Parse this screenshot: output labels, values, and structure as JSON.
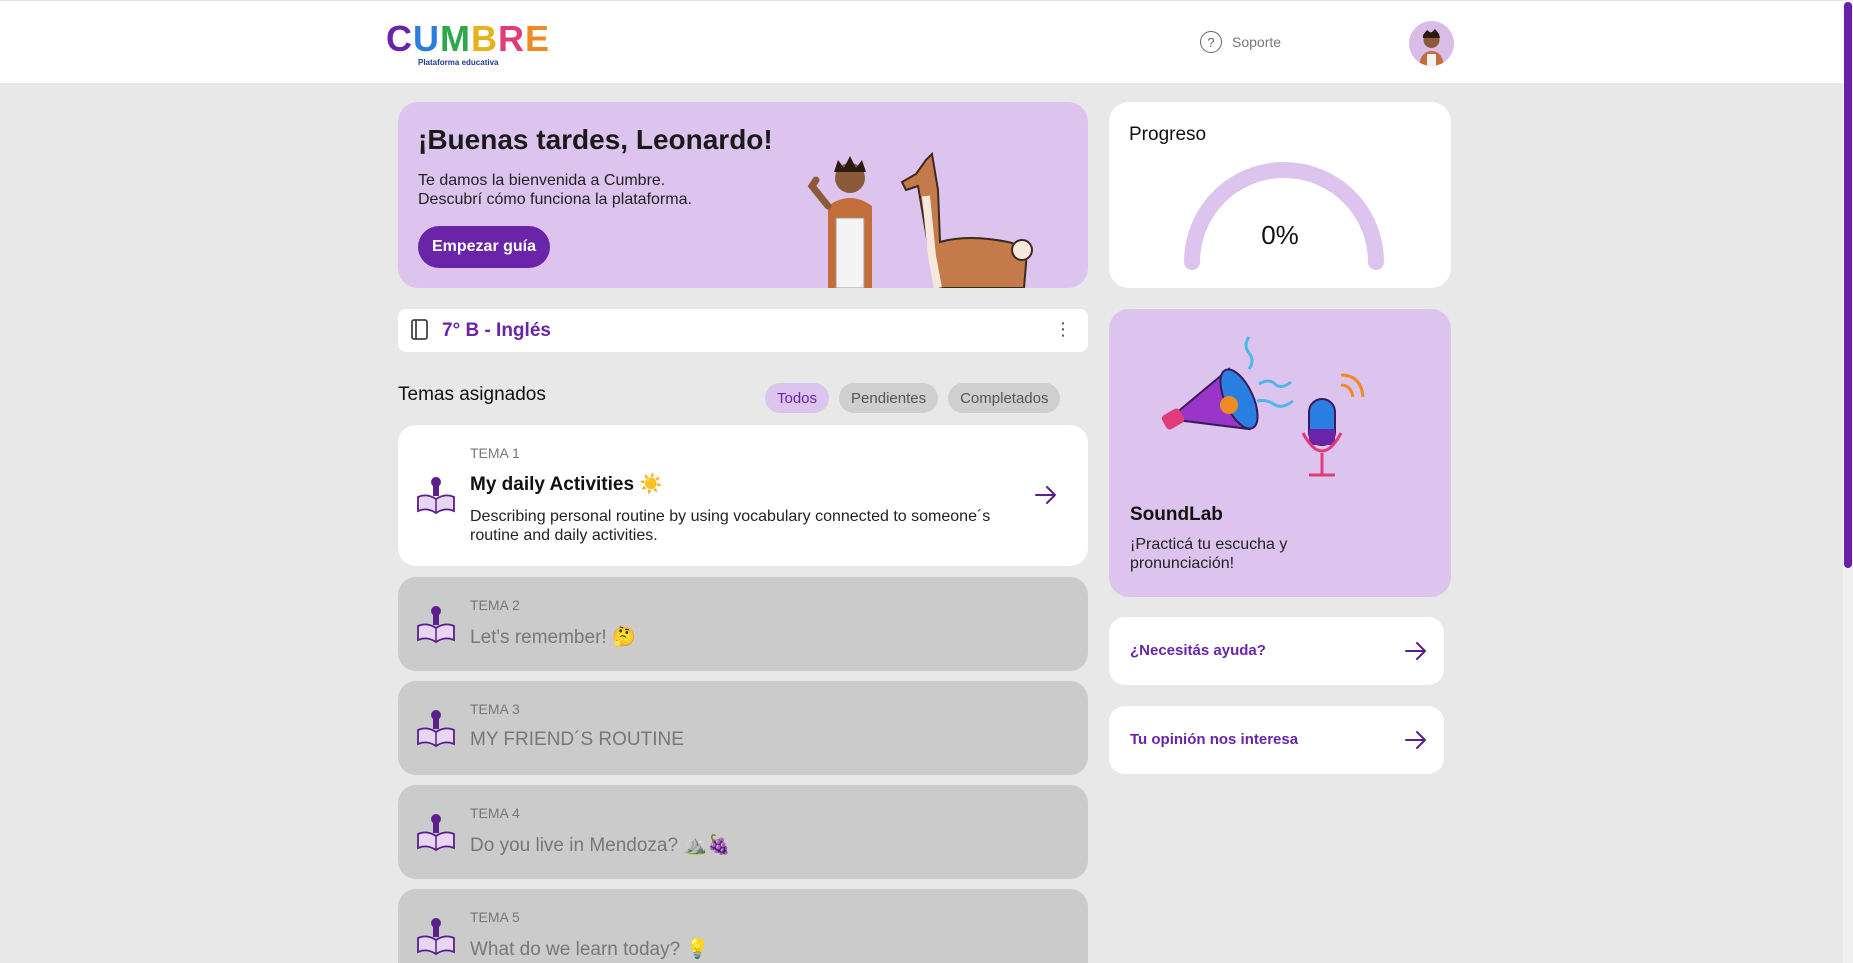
{
  "header": {
    "logo_letters": [
      "C",
      "U",
      "M",
      "B",
      "R",
      "E"
    ],
    "logo_sub": "Plataforma educativa",
    "support_label": "Soporte"
  },
  "welcome": {
    "title": "¡Buenas tardes, Leonardo!",
    "line1": "Te damos la bienvenida a Cumbre.",
    "line2": "Descubrí cómo funciona la plataforma.",
    "button": "Empezar guía"
  },
  "progress": {
    "title": "Progreso",
    "value_label": "0%",
    "value": 0
  },
  "class_bar": {
    "label": "7° B - Inglés"
  },
  "topics_section": {
    "title": "Temas asignados",
    "filters": [
      "Todos",
      "Pendientes",
      "Completados"
    ],
    "active_filter": "Todos"
  },
  "topics": [
    {
      "tema": "TEMA 1",
      "name": "My daily Activities ☀️",
      "desc": "Describing personal routine by using vocabulary connected to someone´s routine and daily activities."
    },
    {
      "tema": "TEMA 2",
      "name": "Let's remember! 🤔"
    },
    {
      "tema": "TEMA 3",
      "name": "MY FRIEND´S ROUTINE"
    },
    {
      "tema": "TEMA 4",
      "name": "Do you live in Mendoza? ⛰️🍇"
    },
    {
      "tema": "TEMA 5",
      "name": "What do we learn today? 💡"
    }
  ],
  "soundlab": {
    "title": "SoundLab",
    "line1": "¡Practicá tu escucha y",
    "line2": "pronunciación!"
  },
  "links": {
    "help": "¿Necesitás ayuda?",
    "feedback": "Tu opinión nos interesa"
  },
  "colors": {
    "brand_purple": "#6a24a8",
    "card_lilac": "#dcc4ee",
    "background": "#e8e8e8"
  }
}
